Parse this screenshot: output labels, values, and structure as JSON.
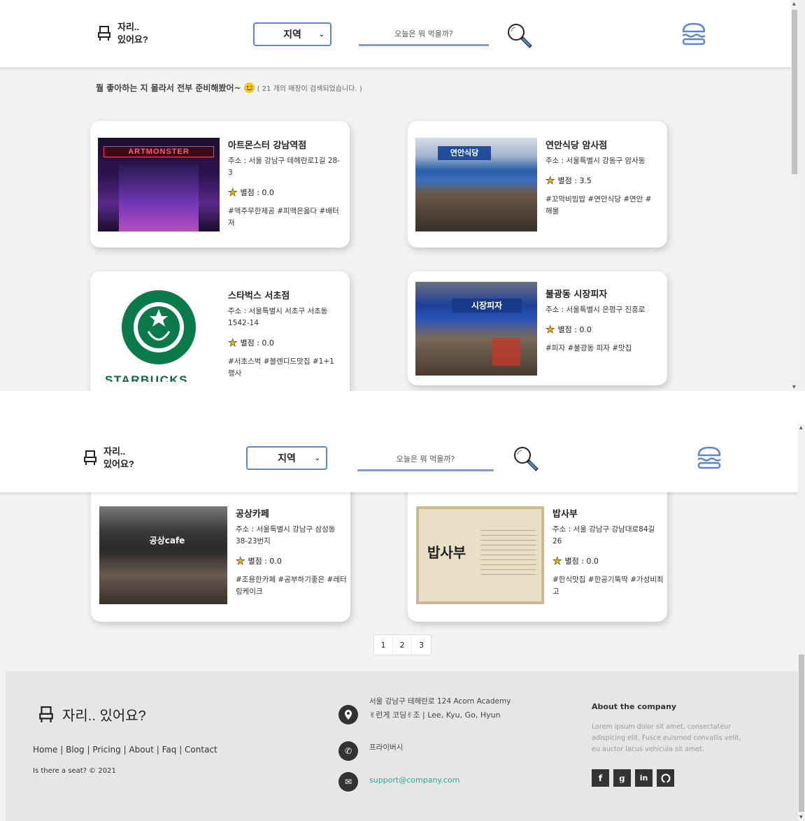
{
  "brand": {
    "line1": "자리..",
    "line2": "있어요?",
    "footer_name": "자리.. 있어요?"
  },
  "header": {
    "region_select": "지역",
    "search_placeholder": "오늘은 뭐 먹을까?"
  },
  "results": {
    "message": "뭘 좋아하는 지 몰라서 전부 준비해봤어~",
    "count_text": "( 21 개의 매장이 검색되었습니다. )"
  },
  "cards": [
    {
      "name": "아트몬스터 강남역점",
      "address": "주소 : 서울 강남구 테헤란로1길 28-3",
      "rating": "별점 : 0.0",
      "tags": "#맥주무한제공 #피맥은옳다 #배터져",
      "image_sign": "ARTMONSTER"
    },
    {
      "name": "연안식당 암사점",
      "address": "주소 : 서울특별시 강동구 암사동",
      "rating": "별점 : 3.5",
      "tags": "#꼬막비빔밥 #연안식당 #연안 #해물",
      "image_sign": "연안식당"
    },
    {
      "name": "스타벅스 서초점",
      "address": "주소 : 서울특별시 서초구 서초동 1542-14",
      "rating": "별점 : 0.0",
      "tags": "#서초스벅 #블렌디드맛집 #1+1행사",
      "image_sign": "STARBUCKS"
    },
    {
      "name": "불광동 시장피자",
      "address": "주소 : 서울특별시 은평구 진흥로",
      "rating": "별점 : 0.0",
      "tags": "#피자 #불광동 피자 #맛집",
      "image_sign": "시장피자"
    },
    {
      "name": "공상카페",
      "address": "주소 : 서울특별시 강남구 삼성동 38-23번지",
      "rating": "별점 : 0.0",
      "tags": "#조용한카페 #공부하기좋은 #레터링케이크",
      "image_sign": "공상cafe"
    },
    {
      "name": "밥사부",
      "address": "주소 : 서울 강남구 강남대로84길 26",
      "rating": "별점 : 0.0",
      "tags": "#한식맛집 #한공기뚝딱 #가성비최고",
      "image_sign": "밥사부"
    }
  ],
  "pagination": [
    "1",
    "2",
    "3"
  ],
  "footer": {
    "links": [
      "Home",
      "Blog",
      "Pricing",
      "About",
      "Faq",
      "Contact"
    ],
    "copyright": "Is there a seat? © 2021",
    "address": "서울 강남구 테헤란로 124 Acorn Academy",
    "team": "✌런게 코딩✌조 | Lee, Kyu, Go, Hyun",
    "privacy": "프라이버시",
    "email": "support@company.com",
    "about_title": "About the company",
    "about_body": "Lorem ipsum dolor sit amet, consectateur adispicing elit. Fusce euismod convallis velit, eu auctor lacus vehicula sit amet.",
    "social": [
      "f",
      "g",
      "in",
      "gh"
    ]
  },
  "icons": {
    "logo": "seat-icon",
    "search": "magnifier-icon",
    "menu": "hamburger-icon"
  },
  "colors": {
    "accent": "#5b84d9",
    "email": "#2aa88f",
    "star": "#f5b400"
  }
}
